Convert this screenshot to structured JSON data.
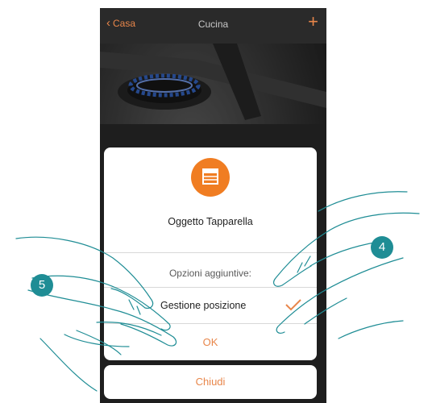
{
  "navbar": {
    "back_label": "Casa",
    "title": "Cucina",
    "add_label": "+"
  },
  "dialog": {
    "object_title": "Oggetto Tapparella",
    "options_label": "Opzioni aggiuntive:",
    "option_item": "Gestione posizione",
    "option_checked": true,
    "ok_label": "OK"
  },
  "close_label": "Chiudi",
  "step_badges": {
    "left": "5",
    "right": "4"
  },
  "colors": {
    "accent": "#e8864a",
    "icon_circle": "#f07d22",
    "badge": "#1f8d95",
    "hand_outline": "#1f8d95"
  }
}
